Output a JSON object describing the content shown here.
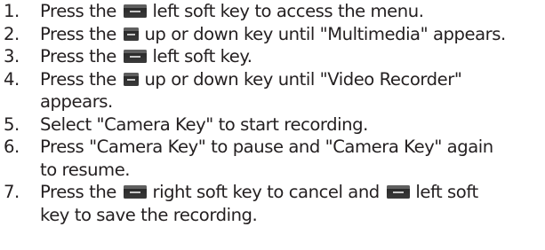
{
  "steps": [
    {
      "number": "1.",
      "lines": [
        {
          "parts": [
            {
              "type": "text",
              "text": "Press the "
            },
            {
              "type": "icon",
              "icon": "soft-key-icon"
            },
            {
              "type": "text",
              "text": " left soft key to access the menu."
            }
          ]
        }
      ]
    },
    {
      "number": "2.",
      "lines": [
        {
          "parts": [
            {
              "type": "text",
              "text": "Press the "
            },
            {
              "type": "icon",
              "icon": "nav-key-icon"
            },
            {
              "type": "text",
              "text": " up or down key until \"Multimedia\" appears."
            }
          ]
        }
      ]
    },
    {
      "number": "3.",
      "lines": [
        {
          "parts": [
            {
              "type": "text",
              "text": "Press the "
            },
            {
              "type": "icon",
              "icon": "soft-key-icon"
            },
            {
              "type": "text",
              "text": " left soft key."
            }
          ]
        }
      ]
    },
    {
      "number": "4.",
      "lines": [
        {
          "parts": [
            {
              "type": "text",
              "text": "Press the "
            },
            {
              "type": "icon",
              "icon": "nav-key-icon"
            },
            {
              "type": "text",
              "text": " up or down key until \"Video Recorder\""
            }
          ]
        },
        {
          "parts": [
            {
              "type": "text",
              "text": "appears."
            }
          ]
        }
      ]
    },
    {
      "number": "5.",
      "lines": [
        {
          "parts": [
            {
              "type": "text",
              "text": "Select \"Camera Key\" to start recording."
            }
          ]
        }
      ]
    },
    {
      "number": "6.",
      "lines": [
        {
          "parts": [
            {
              "type": "text",
              "text": "Press \"Camera Key\" to pause and \"Camera Key\" again"
            }
          ]
        },
        {
          "parts": [
            {
              "type": "text",
              "text": "to resume."
            }
          ]
        }
      ]
    },
    {
      "number": "7.",
      "lines": [
        {
          "parts": [
            {
              "type": "text",
              "text": "Press the "
            },
            {
              "type": "icon",
              "icon": "soft-key-icon"
            },
            {
              "type": "text",
              "text": " right soft key to cancel and "
            },
            {
              "type": "icon",
              "icon": "soft-key-icon"
            },
            {
              "type": "text",
              "text": " left soft"
            }
          ]
        },
        {
          "parts": [
            {
              "type": "text",
              "text": "key to save the recording."
            }
          ]
        }
      ]
    }
  ]
}
